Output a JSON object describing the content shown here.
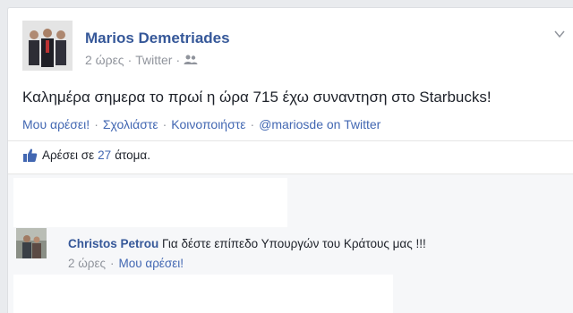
{
  "post": {
    "author": "Marios Demetriades",
    "time": "2 ώρες",
    "source": "Twitter",
    "privacy_icon": "friends-icon",
    "text": "Καλημέρα σημερα το πρωί η ώρα 715 έχω συναντηση στο Starbucks!",
    "actions": {
      "like": "Μου αρέσει!",
      "comment": "Σχολιάστε",
      "share": "Κοινοποιήστε",
      "on_twitter": "@mariosde on Twitter"
    }
  },
  "likes": {
    "prefix": "Αρέσει σε",
    "count": "27",
    "suffix": "άτομα."
  },
  "comments": [
    {
      "author": "Christos Petrou",
      "text": "Για δέστε επίπεδο Υπουργών του Κράτους μας !!!",
      "time": "2 ώρες",
      "like": "Μου αρέσει!"
    }
  ],
  "colors": {
    "link": "#4267b2",
    "author": "#365899",
    "muted": "#90949c"
  }
}
